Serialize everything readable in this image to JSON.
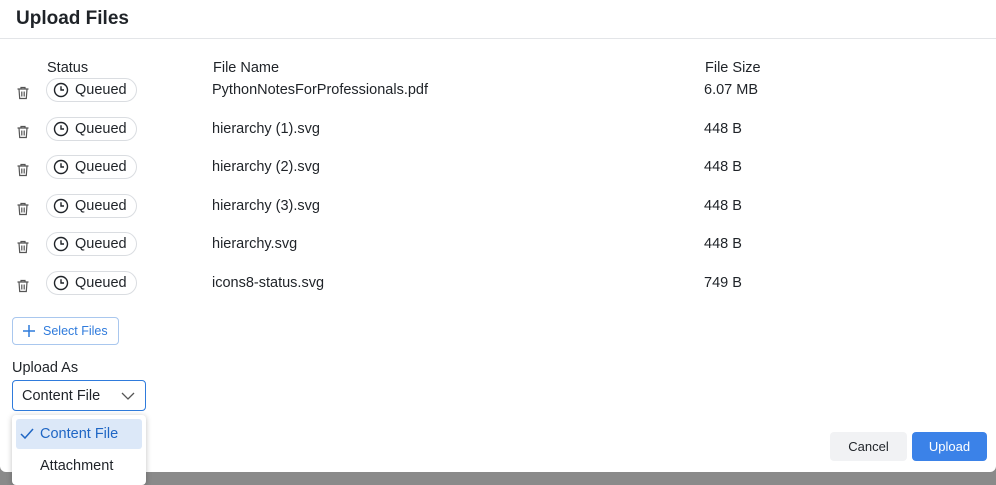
{
  "dialog": {
    "title": "Upload Files"
  },
  "table": {
    "headers": {
      "status": "Status",
      "file_name": "File Name",
      "file_size": "File Size"
    },
    "rows": [
      {
        "status": "Queued",
        "name": "PythonNotesForProfessionals.pdf",
        "size": "6.07 MB"
      },
      {
        "status": "Queued",
        "name": "hierarchy (1).svg",
        "size": "448 B"
      },
      {
        "status": "Queued",
        "name": "hierarchy (2).svg",
        "size": "448 B"
      },
      {
        "status": "Queued",
        "name": "hierarchy (3).svg",
        "size": "448 B"
      },
      {
        "status": "Queued",
        "name": "hierarchy.svg",
        "size": "448 B"
      },
      {
        "status": "Queued",
        "name": "icons8-status.svg",
        "size": "749 B"
      }
    ]
  },
  "select_files": {
    "label": "Select Files",
    "icon": "plus-icon"
  },
  "upload_as": {
    "label": "Upload As",
    "selected": "Content File",
    "options": [
      {
        "label": "Content File",
        "selected": true
      },
      {
        "label": "Attachment",
        "selected": false
      }
    ]
  },
  "footer": {
    "cancel_label": "Cancel",
    "upload_label": "Upload"
  },
  "icons": {
    "row_delete": "trash-icon",
    "status": "clock-icon",
    "dropdown": "chevron-down-icon",
    "selected_option": "check-icon"
  },
  "colors": {
    "accent": "#2f7bdc",
    "primary_button": "#3b82e8",
    "selected_option_bg": "#dce8f8"
  }
}
